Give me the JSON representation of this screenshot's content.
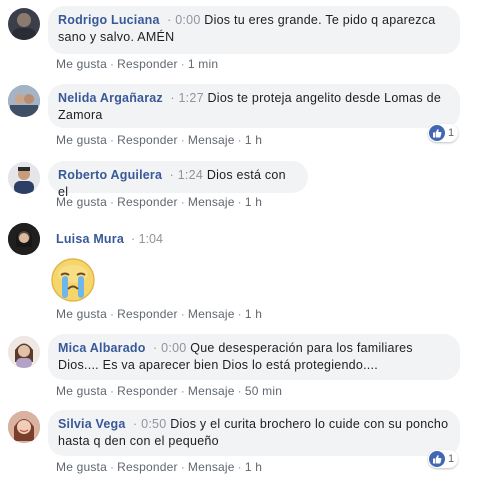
{
  "colors": {
    "author": "#385898",
    "meta": "#90949c",
    "bubble": "#f2f3f5",
    "like": "#4267b2"
  },
  "comments": [
    {
      "author": "Rodrigo Luciana",
      "time": "0:00",
      "lines": [
        "Dios tu eres grande. Te pido q aparezca",
        "sano y salvo. AMÉN"
      ],
      "actions": [
        "Me gusta",
        "Responder",
        "1 min"
      ],
      "reactions": null
    },
    {
      "author": "Nelida Argañaraz",
      "time": "1:27",
      "lines": [
        "Dios te proteja angelito desde Lomas de",
        "Zamora"
      ],
      "actions": [
        "Me gusta",
        "Responder",
        "Mensaje",
        "1 h"
      ],
      "reactions": {
        "icon": "like-icon",
        "count": "1"
      }
    },
    {
      "author": "Roberto Aguilera",
      "time": "1:24",
      "lines": [
        "Dios está con el"
      ],
      "actions": [
        "Me gusta",
        "Responder",
        "Mensaje",
        "1 h"
      ],
      "reactions": null
    },
    {
      "author": "Luisa Mura",
      "time": "1:04",
      "sticker": "crying-face-sticker",
      "actions": [
        "Me gusta",
        "Responder",
        "Mensaje",
        "1 h"
      ],
      "reactions": null
    },
    {
      "author": "Mica Albarado",
      "time": "0:00",
      "lines": [
        "Que desesperación para los familiares",
        "Dios.... Es va aparecer bien Dios lo está protegiendo...."
      ],
      "actions": [
        "Me gusta",
        "Responder",
        "Mensaje",
        "50 min"
      ],
      "reactions": null
    },
    {
      "author": "Silvia Vega",
      "time": "0:50",
      "lines": [
        "Dios y el curita brochero lo cuide con su poncho",
        "hasta q den con el pequeño"
      ],
      "actions": [
        "Me gusta",
        "Responder",
        "Mensaje",
        "1 h"
      ],
      "reactions": {
        "icon": "like-icon",
        "count": "1"
      }
    }
  ]
}
